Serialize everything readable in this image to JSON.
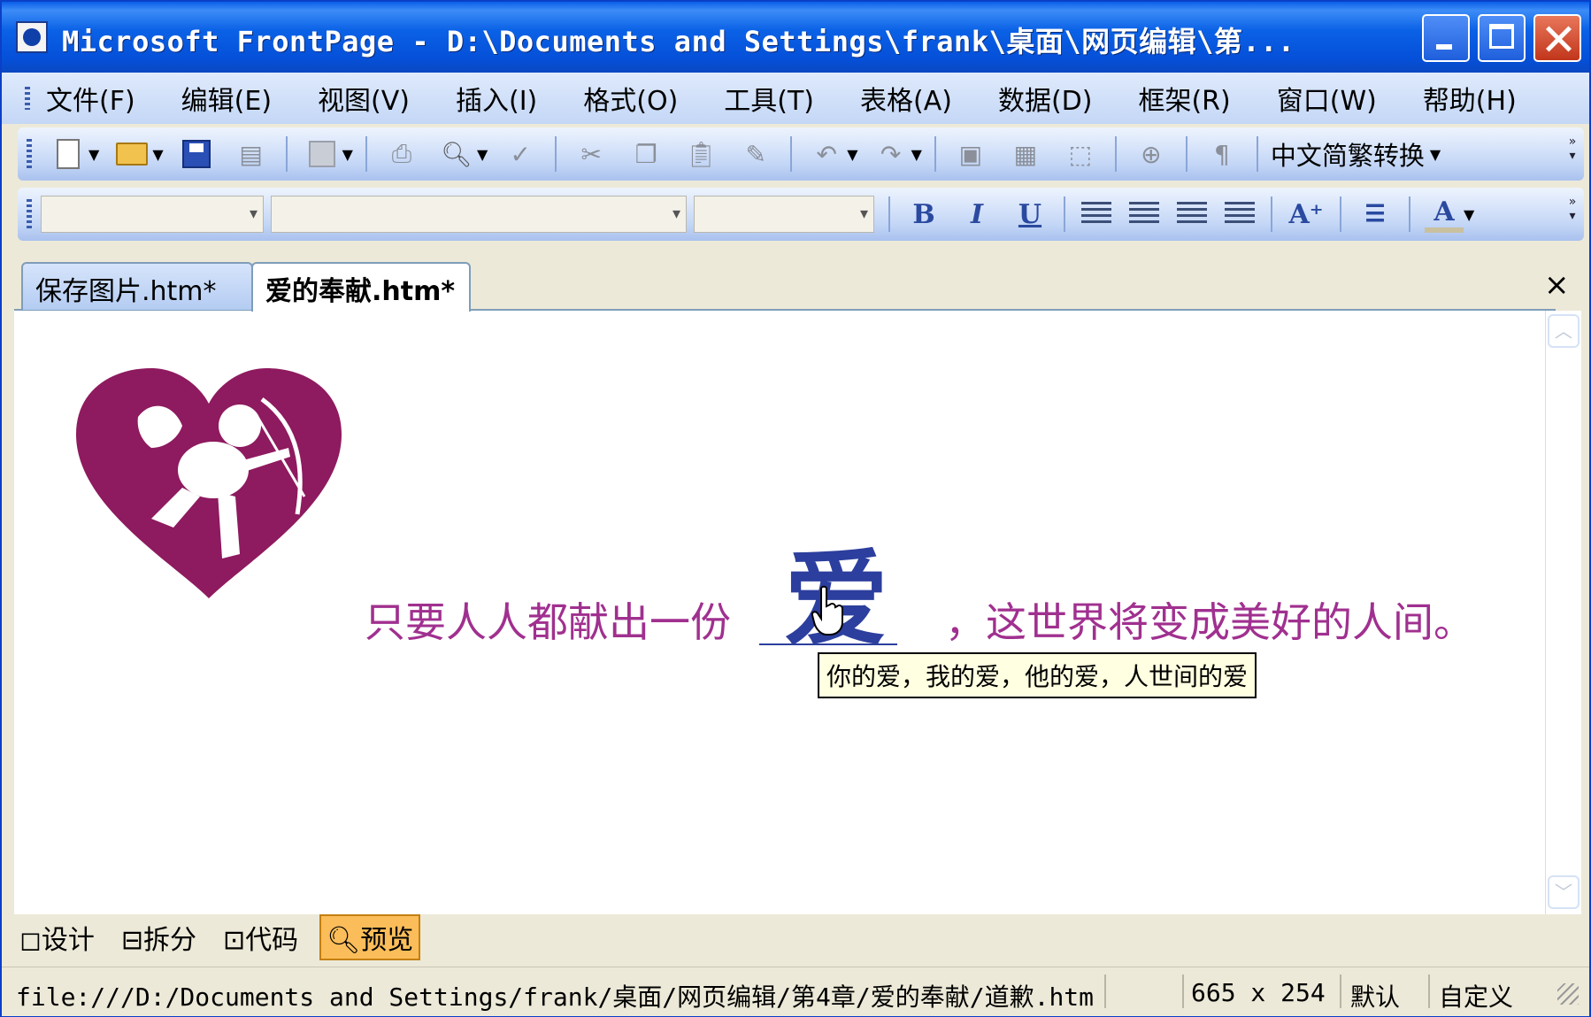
{
  "window": {
    "title": "Microsoft FrontPage - D:\\Documents and Settings\\frank\\桌面\\网页编辑\\第..."
  },
  "menu": [
    "文件(F)",
    "编辑(E)",
    "视图(V)",
    "插入(I)",
    "格式(O)",
    "工具(T)",
    "表格(A)",
    "数据(D)",
    "框架(R)",
    "窗口(W)",
    "帮助(H)"
  ],
  "toolbar": {
    "convert_label": "中文简繁转换",
    "icons": [
      "new-page-icon",
      "open-folder-icon",
      "save-icon",
      "publish-icon",
      "web-component-icon",
      "print-icon",
      "print-preview-icon",
      "spelling-icon",
      "cut-icon",
      "copy-icon",
      "paste-icon",
      "format-painter-icon",
      "undo-icon",
      "redo-icon",
      "insert-image-icon",
      "insert-table-icon",
      "insert-layer-icon",
      "hyperlink-icon",
      "show-formatting-icon"
    ]
  },
  "format_toolbar": {
    "style_value": "",
    "font_value": "",
    "size_value": "",
    "bold": "B",
    "italic": "I",
    "underline": "U",
    "font_color_glyph": "A"
  },
  "tabs": [
    {
      "label": "保存图片.htm*",
      "active": false
    },
    {
      "label": "爱的奉献.htm*",
      "active": true
    }
  ],
  "tab_close": "×",
  "page": {
    "text_left": "只要人人都献出一份",
    "ai_char": "爱",
    "text_right": "，这世界将变成美好的人间。",
    "tooltip": "你的爱，我的爱，他的爱，人世间的爱",
    "heart_color": "#8e1a5f",
    "text_color": "#a0308f",
    "ai_color": "#2c3f9e"
  },
  "view_tabs": [
    {
      "label": "设计",
      "active": false
    },
    {
      "label": "拆分",
      "active": false
    },
    {
      "label": "代码",
      "active": false
    },
    {
      "label": "预览",
      "active": true
    }
  ],
  "status": {
    "path": "file:///D:/Documents and Settings/frank/桌面/网页编辑/第4章/爱的奉献/道歉.htm",
    "dimensions": "665 x 254",
    "default": "默认",
    "custom": "自定义"
  }
}
